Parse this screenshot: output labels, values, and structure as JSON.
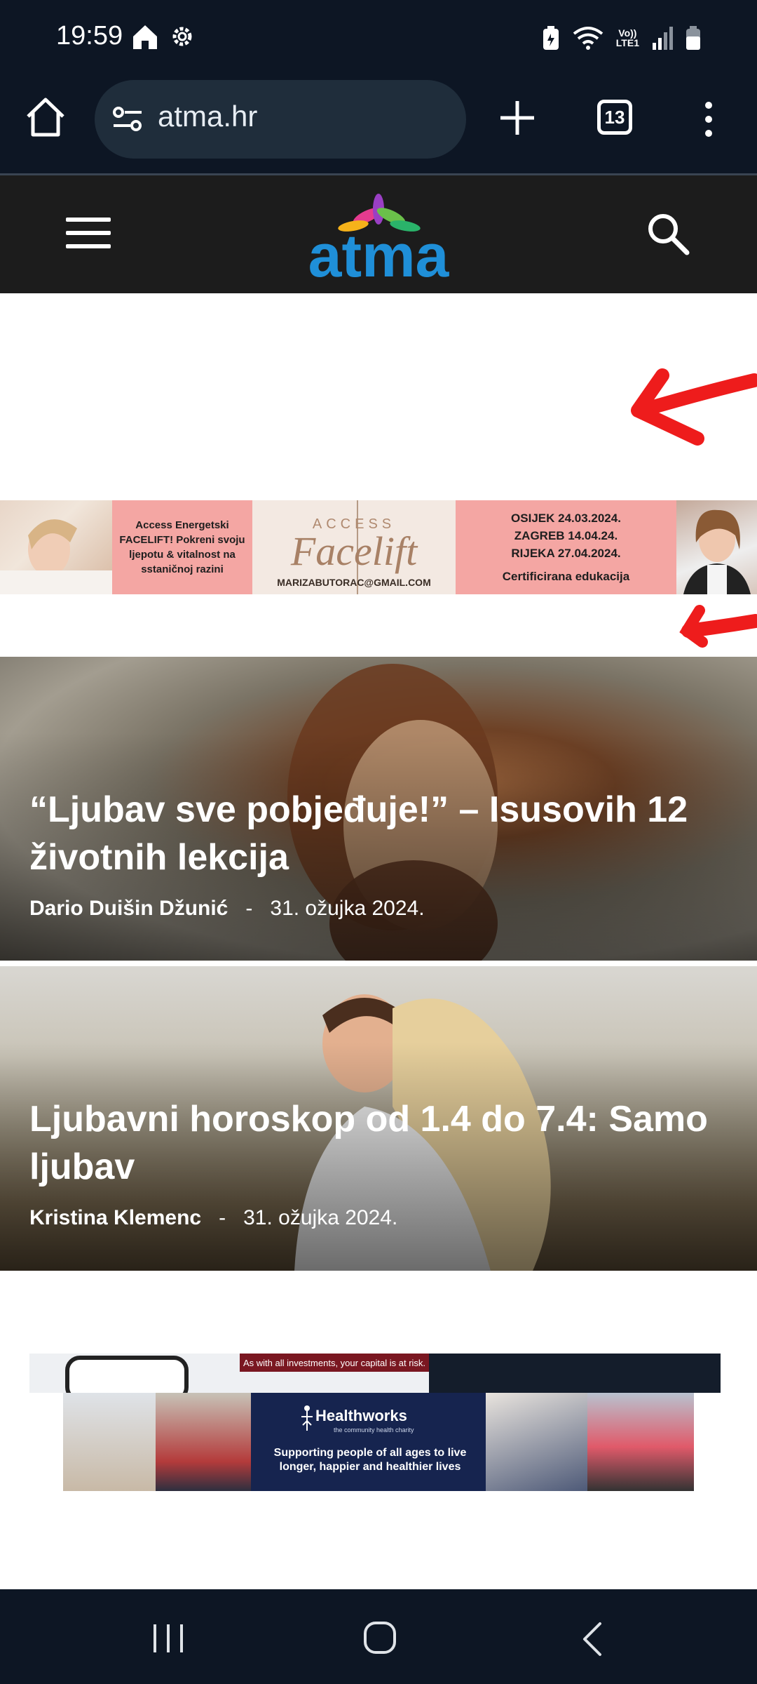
{
  "status_bar": {
    "time": "19:59",
    "volte_top": "Vo))",
    "volte_bottom": "LTE1"
  },
  "browser": {
    "url": "atma.hr",
    "tab_count": "13"
  },
  "site": {
    "logo_text": "atma"
  },
  "ad_banner_1": {
    "text_left": "Access Energetski FACELIFT! Pokreni svoju ljepotu & vitalnost na sstaničnoj razini",
    "logo_top": "ACCESS",
    "logo_script": "Facelift",
    "email": "MARIZABUTORAC@GMAIL.COM",
    "date_1": "OSIJEK 24.03.2024.",
    "date_2": "ZAGREB 14.04.24.",
    "date_3": "RIJEKA 27.04.2024.",
    "cert": "Certificirana edukacija"
  },
  "articles": [
    {
      "title": "“Ljubav sve pobjeđuje!” – Isusovih 12 životnih lekcija",
      "author": "Dario Duišin Džunić",
      "separator": "-",
      "date": "31. ožujka 2024."
    },
    {
      "title": "Ljubavni horoskop od 1.4 do 7.4: Samo ljubav",
      "author": "Kristina Klemenc",
      "separator": "-",
      "date": "31. ožujka 2024."
    }
  ],
  "ad_banner_2": {
    "top_notice": "As with all investments, your capital is at risk.",
    "brand": "Healthworks",
    "sub": "the community health charity",
    "tagline": "Supporting people of all ages to live longer, happier and healthier lives"
  },
  "colors": {
    "system_bar": "#0d1624",
    "url_bar": "#1f2d3b",
    "site_header": "#1c1c1c",
    "ad_pink": "#f4a6a3",
    "annotation_red": "#ee1c1c"
  }
}
